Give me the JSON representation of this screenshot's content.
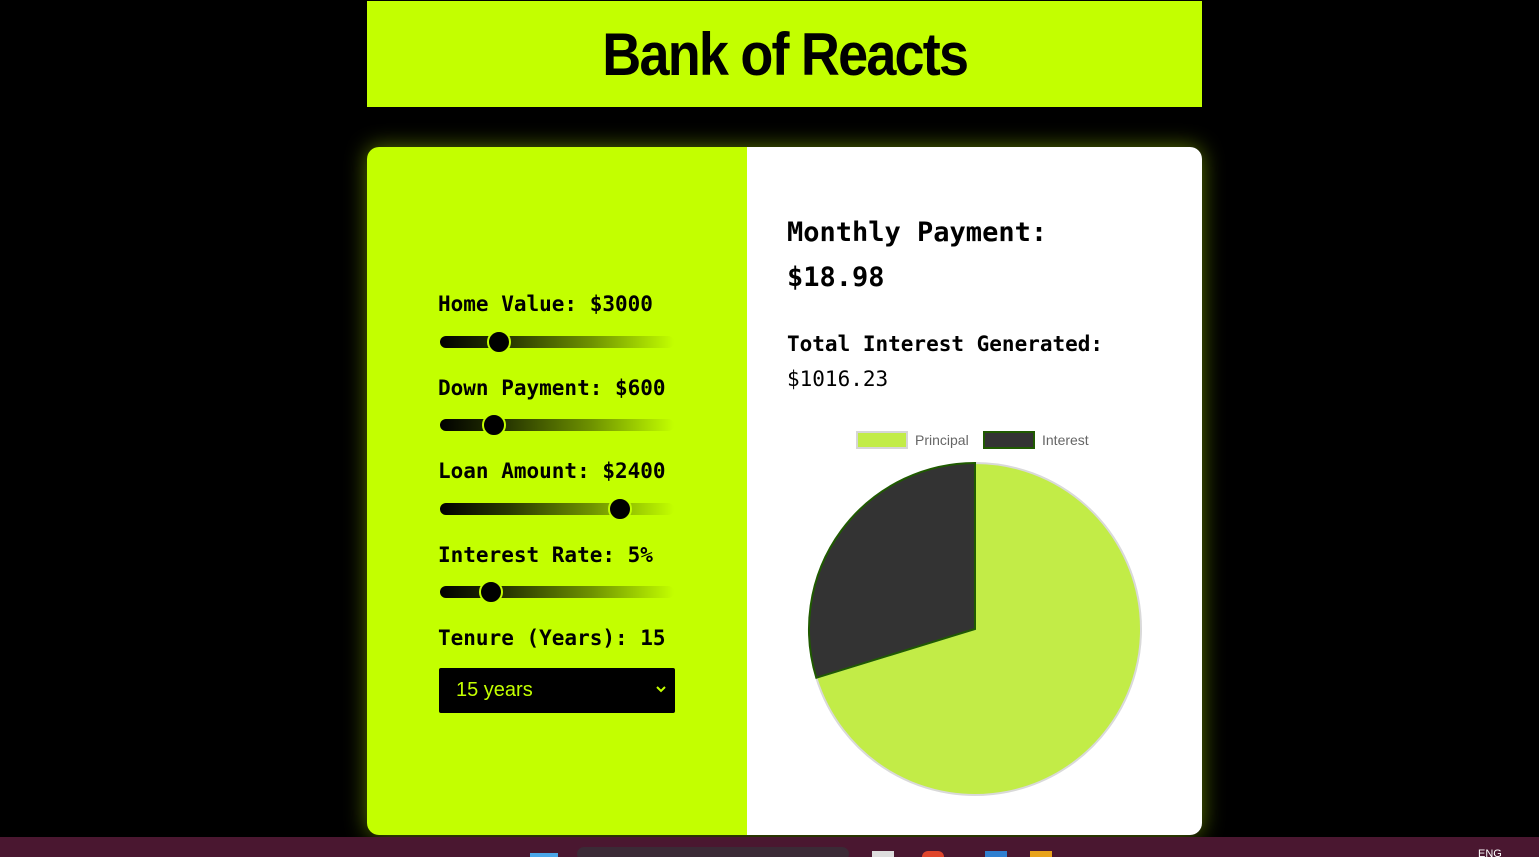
{
  "header": {
    "title": "Bank of Reacts"
  },
  "controls": {
    "home_value": {
      "label": "Home Value: $3000",
      "min": 1000,
      "max": 10000,
      "value": 3000
    },
    "down_payment": {
      "label": "Down Payment: $600",
      "min": 0,
      "max": 3000,
      "value": 600
    },
    "loan_amount": {
      "label": "Loan Amount: $2400",
      "min": 0,
      "max": 3000,
      "value": 2400
    },
    "interest_rate": {
      "label": "Interest Rate: 5%",
      "min": 2,
      "max": 18,
      "value": 5
    },
    "tenure": {
      "label": "Tenure (Years): 15",
      "selected": "15 years"
    }
  },
  "results": {
    "monthly_label": "Monthly Payment:",
    "monthly_value": "$18.98",
    "interest_label": "Total Interest Generated:",
    "interest_value": "$1016.23"
  },
  "chart_data": {
    "type": "pie",
    "categories": [
      "Principal",
      "Interest"
    ],
    "values": [
      2400,
      1016.23
    ],
    "colors": [
      "#c2ec47",
      "#333333"
    ],
    "legend": "top"
  },
  "taskbar": {
    "lang": "ENG"
  }
}
